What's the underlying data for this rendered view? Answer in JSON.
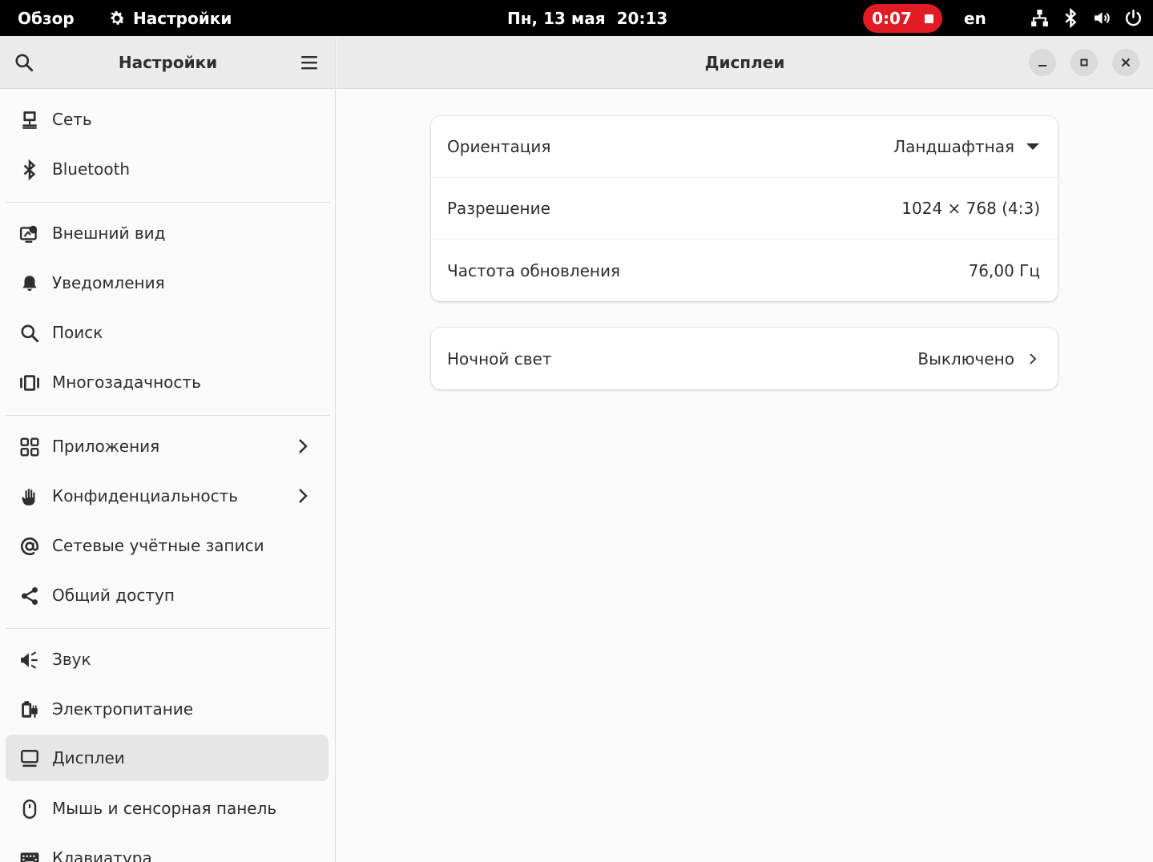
{
  "topbar": {
    "overview": "Обзор",
    "app_name": "Настройки",
    "date": "Пн, 13 мая",
    "time": "20:13",
    "recording_time": "0:07",
    "language": "en"
  },
  "sidebar": {
    "title": "Настройки",
    "items": [
      {
        "label": "Сеть",
        "icon": "network-icon"
      },
      {
        "label": "Bluetooth",
        "icon": "bluetooth-icon"
      },
      {
        "label": "Внешний вид",
        "icon": "appearance-icon"
      },
      {
        "label": "Уведомления",
        "icon": "bell-icon"
      },
      {
        "label": "Поиск",
        "icon": "search-icon"
      },
      {
        "label": "Многозадачность",
        "icon": "multitasking-icon"
      },
      {
        "label": "Приложения",
        "icon": "apps-grid-icon"
      },
      {
        "label": "Конфиденциальность",
        "icon": "hand-icon"
      },
      {
        "label": "Сетевые учётные записи",
        "icon": "at-sign-icon"
      },
      {
        "label": "Общий доступ",
        "icon": "share-icon"
      },
      {
        "label": "Звук",
        "icon": "speaker-icon"
      },
      {
        "label": "Электропитание",
        "icon": "power-plug-icon"
      },
      {
        "label": "Дисплеи",
        "icon": "display-icon",
        "active": true
      },
      {
        "label": "Мышь и сенсорная панель",
        "icon": "mouse-icon"
      },
      {
        "label": "Клавиатура",
        "icon": "keyboard-icon"
      }
    ]
  },
  "main": {
    "title": "Дисплеи",
    "display_settings": [
      {
        "label": "Ориентация",
        "value": "Ландшафтная"
      },
      {
        "label": "Разрешение",
        "value": "1024 × 768 (4:3)"
      },
      {
        "label": "Частота обновления",
        "value": "76,00 Гц"
      }
    ],
    "night_light": {
      "label": "Ночной свет",
      "value": "Выключено"
    }
  },
  "colors": {
    "topbar_bg": "#000000",
    "recording_bg": "#e01b24",
    "header_bg": "#ebebeb",
    "active_item_bg": "#e6e6e6"
  }
}
